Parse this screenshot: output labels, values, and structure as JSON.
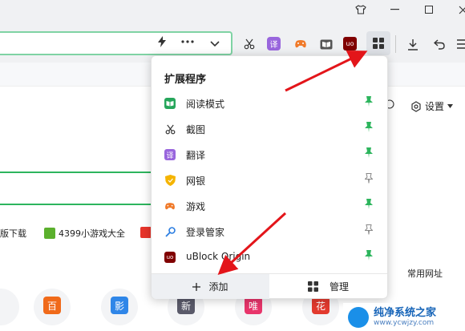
{
  "window": {
    "minimize": "—",
    "maximize": "☐",
    "close": "✕",
    "skin": "👕"
  },
  "toolbar": {
    "lightning": "⚡",
    "more": "•••",
    "dropdown": "⌄",
    "translate_badge": "译",
    "ublock_badge": "uo"
  },
  "popup": {
    "title": "扩展程序",
    "items": [
      {
        "label": "阅读模式",
        "icon": "reader-icon",
        "color": "#26a65b",
        "pinned": true
      },
      {
        "label": "截图",
        "icon": "scissors-icon",
        "color": "#444444",
        "pinned": true
      },
      {
        "label": "翻译",
        "icon": "translate-icon",
        "color": "#9966dd",
        "pinned": true
      },
      {
        "label": "网银",
        "icon": "shield-icon",
        "color": "#f5b400",
        "pinned": false
      },
      {
        "label": "游戏",
        "icon": "gamepad-icon",
        "color": "#f07a2a",
        "pinned": true
      },
      {
        "label": "登录管家",
        "icon": "key-icon",
        "color": "#2a7de1",
        "pinned": false
      },
      {
        "label": "uBlock Origin",
        "icon": "ublock-icon",
        "color": "#800000",
        "pinned": true
      }
    ],
    "add_label": "添加",
    "manage_label": "管理"
  },
  "page": {
    "settings_label": "设置",
    "common_sites": "常用网址",
    "bookmarks": [
      "版下载",
      "4399小游戏大全"
    ],
    "tiles": [
      {
        "glyph": "百",
        "color": "#f06a1a"
      },
      {
        "glyph": "影",
        "color": "#2f86e8"
      },
      {
        "glyph": "新",
        "color": "#5a5a6a"
      },
      {
        "glyph": "唯",
        "color": "#e8356b"
      },
      {
        "glyph": "花",
        "color": "#e23a2e"
      }
    ]
  },
  "watermark": {
    "main": "纯净系统之家",
    "sub": "www.ycwjzy.com"
  },
  "colors": {
    "pin_active": "#2db55d",
    "pin_inactive": "#888888",
    "arrow": "#e3151a",
    "accent_green": "#2db55d"
  }
}
